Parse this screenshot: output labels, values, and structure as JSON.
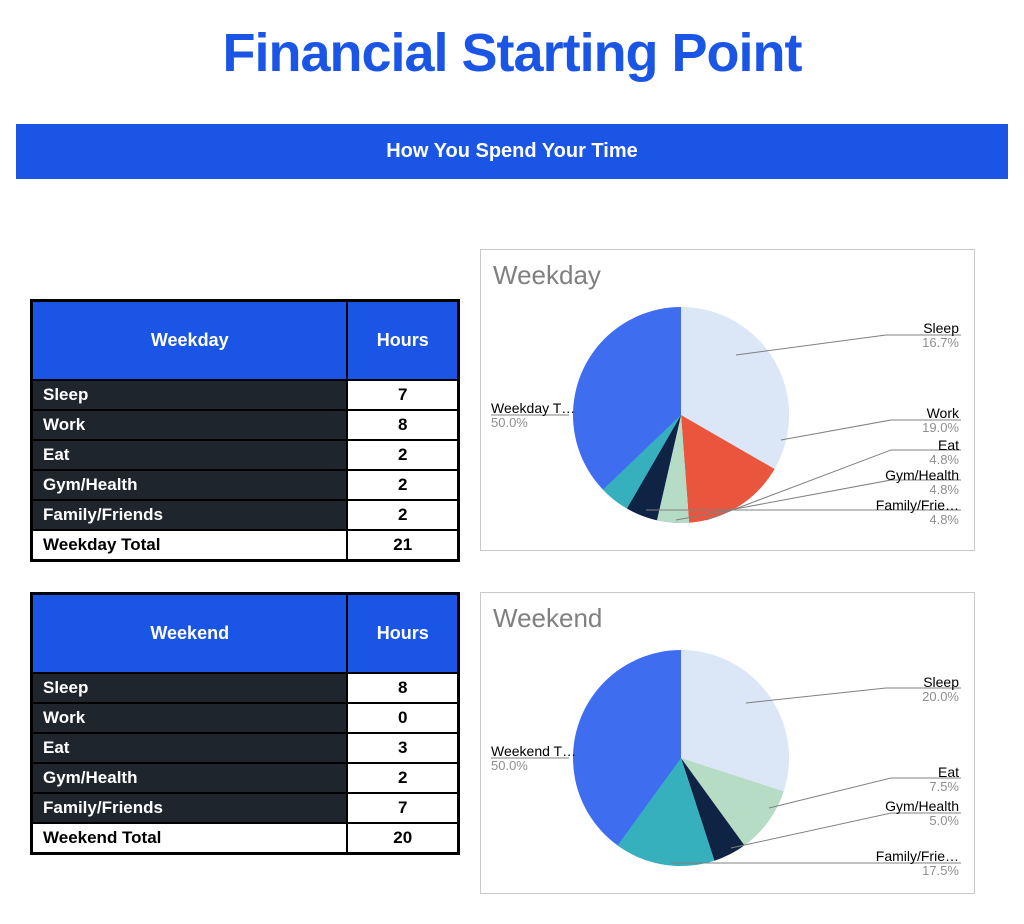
{
  "title": "Financial Starting Point",
  "banner": "How You Spend Your Time",
  "tables": {
    "weekday": {
      "header_label": "Weekday",
      "header_hours": "Hours",
      "rows": [
        {
          "label": "Sleep",
          "value": "7"
        },
        {
          "label": "Work",
          "value": "8"
        },
        {
          "label": "Eat",
          "value": "2"
        },
        {
          "label": "Gym/Health",
          "value": "2"
        },
        {
          "label": "Family/Friends",
          "value": "2"
        }
      ],
      "total_label": "Weekday Total",
      "total_value": "21"
    },
    "weekend": {
      "header_label": "Weekend",
      "header_hours": "Hours",
      "rows": [
        {
          "label": "Sleep",
          "value": "8"
        },
        {
          "label": "Work",
          "value": "0"
        },
        {
          "label": "Eat",
          "value": "3"
        },
        {
          "label": "Gym/Health",
          "value": "2"
        },
        {
          "label": "Family/Friends",
          "value": "7"
        }
      ],
      "total_label": "Weekend Total",
      "total_value": "20"
    }
  },
  "charts": {
    "weekday": {
      "title": "Weekday",
      "total_label": "Weekday T…",
      "total_pct": "50.0%",
      "slices": [
        {
          "label": "Sleep",
          "pct": "16.7%"
        },
        {
          "label": "Work",
          "pct": "19.0%"
        },
        {
          "label": "Eat",
          "pct": "4.8%"
        },
        {
          "label": "Gym/Health",
          "pct": "4.8%"
        },
        {
          "label": "Family/Frie…",
          "pct": "4.8%"
        }
      ]
    },
    "weekend": {
      "title": "Weekend",
      "total_label": "Weekend T…",
      "total_pct": "50.0%",
      "slices": [
        {
          "label": "Sleep",
          "pct": "20.0%"
        },
        {
          "label": "Eat",
          "pct": "7.5%"
        },
        {
          "label": "Gym/Health",
          "pct": "5.0%"
        },
        {
          "label": "Family/Frie…",
          "pct": "17.5%"
        }
      ]
    }
  },
  "colors": {
    "accent": "#1a55e6",
    "slice_total": "#3f6df0",
    "slice_sleep": "#dbe6f7",
    "slice_work": "#e9553d",
    "slice_eat": "#b6dcc5",
    "slice_gym": "#0f2344",
    "slice_family": "#36b0bd"
  },
  "chart_data": [
    {
      "type": "pie",
      "title": "Weekday",
      "series": [
        {
          "name": "Weekday Total",
          "value": 21,
          "percent": 50.0
        },
        {
          "name": "Sleep",
          "value": 7,
          "percent": 16.7
        },
        {
          "name": "Work",
          "value": 8,
          "percent": 19.0
        },
        {
          "name": "Eat",
          "value": 2,
          "percent": 4.8
        },
        {
          "name": "Gym/Health",
          "value": 2,
          "percent": 4.8
        },
        {
          "name": "Family/Friends",
          "value": 2,
          "percent": 4.8
        }
      ]
    },
    {
      "type": "pie",
      "title": "Weekend",
      "series": [
        {
          "name": "Weekend Total",
          "value": 20,
          "percent": 50.0
        },
        {
          "name": "Sleep",
          "value": 8,
          "percent": 20.0
        },
        {
          "name": "Work",
          "value": 0,
          "percent": 0.0
        },
        {
          "name": "Eat",
          "value": 3,
          "percent": 7.5
        },
        {
          "name": "Gym/Health",
          "value": 2,
          "percent": 5.0
        },
        {
          "name": "Family/Friends",
          "value": 7,
          "percent": 17.5
        }
      ]
    }
  ]
}
